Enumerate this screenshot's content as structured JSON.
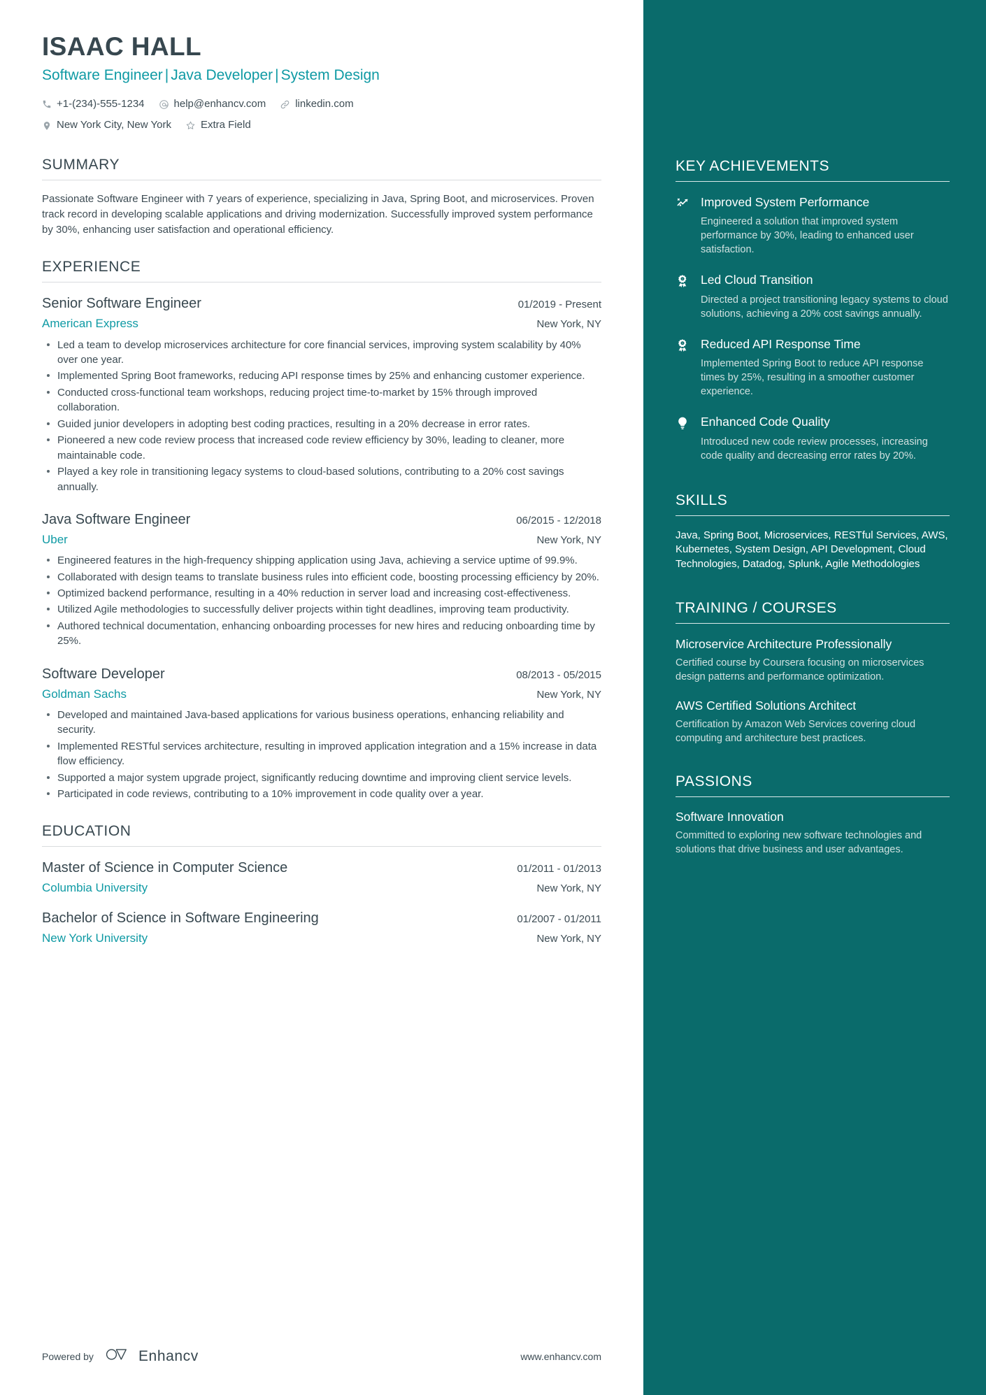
{
  "header": {
    "name": "ISAAC HALL",
    "headline_parts": [
      "Software Engineer",
      "Java Developer",
      "System Design"
    ],
    "separator": "|",
    "contacts": [
      {
        "icon": "phone-icon",
        "text": "+1-(234)-555-1234"
      },
      {
        "icon": "email-icon",
        "text": "help@enhancv.com"
      },
      {
        "icon": "link-icon",
        "text": "linkedin.com"
      },
      {
        "icon": "location-icon",
        "text": "New York City, New York"
      },
      {
        "icon": "star-icon",
        "text": "Extra Field"
      }
    ]
  },
  "summary": {
    "title": "SUMMARY",
    "text": "Passionate Software Engineer with 7 years of experience, specializing in Java, Spring Boot, and microservices. Proven track record in developing scalable applications and driving modernization. Successfully improved system performance by 30%, enhancing user satisfaction and operational efficiency."
  },
  "experience": {
    "title": "EXPERIENCE",
    "entries": [
      {
        "role": "Senior Software Engineer",
        "date": "01/2019 - Present",
        "company": "American Express",
        "location": "New York, NY",
        "bullets": [
          "Led a team to develop microservices architecture for core financial services, improving system scalability by 40% over one year.",
          "Implemented Spring Boot frameworks, reducing API response times by 25% and enhancing customer experience.",
          "Conducted cross-functional team workshops, reducing project time-to-market by 15% through improved collaboration.",
          "Guided junior developers in adopting best coding practices, resulting in a 20% decrease in error rates.",
          "Pioneered a new code review process that increased code review efficiency by 30%, leading to cleaner, more maintainable code.",
          "Played a key role in transitioning legacy systems to cloud-based solutions, contributing to a 20% cost savings annually."
        ]
      },
      {
        "role": "Java Software Engineer",
        "date": "06/2015 - 12/2018",
        "company": "Uber",
        "location": "New York, NY",
        "bullets": [
          "Engineered features in the high-frequency shipping application using Java, achieving a service uptime of 99.9%.",
          "Collaborated with design teams to translate business rules into efficient code, boosting processing efficiency by 20%.",
          "Optimized backend performance, resulting in a 40% reduction in server load and increasing cost-effectiveness.",
          "Utilized Agile methodologies to successfully deliver projects within tight deadlines, improving team productivity.",
          "Authored technical documentation, enhancing onboarding processes for new hires and reducing onboarding time by 25%."
        ]
      },
      {
        "role": "Software Developer",
        "date": "08/2013 - 05/2015",
        "company": "Goldman Sachs",
        "location": "New York, NY",
        "bullets": [
          "Developed and maintained Java-based applications for various business operations, enhancing reliability and security.",
          "Implemented RESTful services architecture, resulting in improved application integration and a 15% increase in data flow efficiency.",
          "Supported a major system upgrade project, significantly reducing downtime and improving client service levels.",
          "Participated in code reviews, contributing to a 10% improvement in code quality over a year."
        ]
      }
    ]
  },
  "education": {
    "title": "EDUCATION",
    "entries": [
      {
        "degree": "Master of Science in Computer Science",
        "date": "01/2011 - 01/2013",
        "school": "Columbia University",
        "location": "New York, NY"
      },
      {
        "degree": "Bachelor of Science in Software Engineering",
        "date": "01/2007 - 01/2011",
        "school": "New York University",
        "location": "New York, NY"
      }
    ]
  },
  "footer": {
    "powered_by": "Powered by",
    "brand": "Enhancv",
    "website": "www.enhancv.com"
  },
  "sidebar": {
    "key_achievements": {
      "title": "KEY ACHIEVEMENTS",
      "items": [
        {
          "icon": "trending-arrow-icon",
          "title": "Improved System Performance",
          "desc": "Engineered a solution that improved system performance by 30%, leading to enhanced user satisfaction."
        },
        {
          "icon": "award-medal-icon",
          "title": "Led Cloud Transition",
          "desc": "Directed a project transitioning legacy systems to cloud solutions, achieving a 20% cost savings annually."
        },
        {
          "icon": "award-medal-icon",
          "title": "Reduced API Response Time",
          "desc": "Implemented Spring Boot to reduce API response times by 25%, resulting in a smoother customer experience."
        },
        {
          "icon": "lightbulb-icon",
          "title": "Enhanced Code Quality",
          "desc": "Introduced new code review processes, increasing code quality and decreasing error rates by 20%."
        }
      ]
    },
    "skills": {
      "title": "SKILLS",
      "text": "Java, Spring Boot, Microservices, RESTful Services, AWS, Kubernetes, System Design, API Development, Cloud Technologies, Datadog, Splunk, Agile Methodologies"
    },
    "training": {
      "title": "TRAINING / COURSES",
      "items": [
        {
          "title": "Microservice Architecture Professionally",
          "desc": "Certified course by Coursera focusing on microservices design patterns and performance optimization."
        },
        {
          "title": "AWS Certified Solutions Architect",
          "desc": "Certification by Amazon Web Services covering cloud computing and architecture best practices."
        }
      ]
    },
    "passions": {
      "title": "PASSIONS",
      "items": [
        {
          "title": "Software Innovation",
          "desc": "Committed to exploring new software technologies and solutions that drive business and user advantages."
        }
      ]
    }
  },
  "colors": {
    "accent_teal": "#0f9aa4",
    "sidebar_bg": "#0a6b6b",
    "heading_dark": "#37474f",
    "body_text": "#3d4c54"
  }
}
